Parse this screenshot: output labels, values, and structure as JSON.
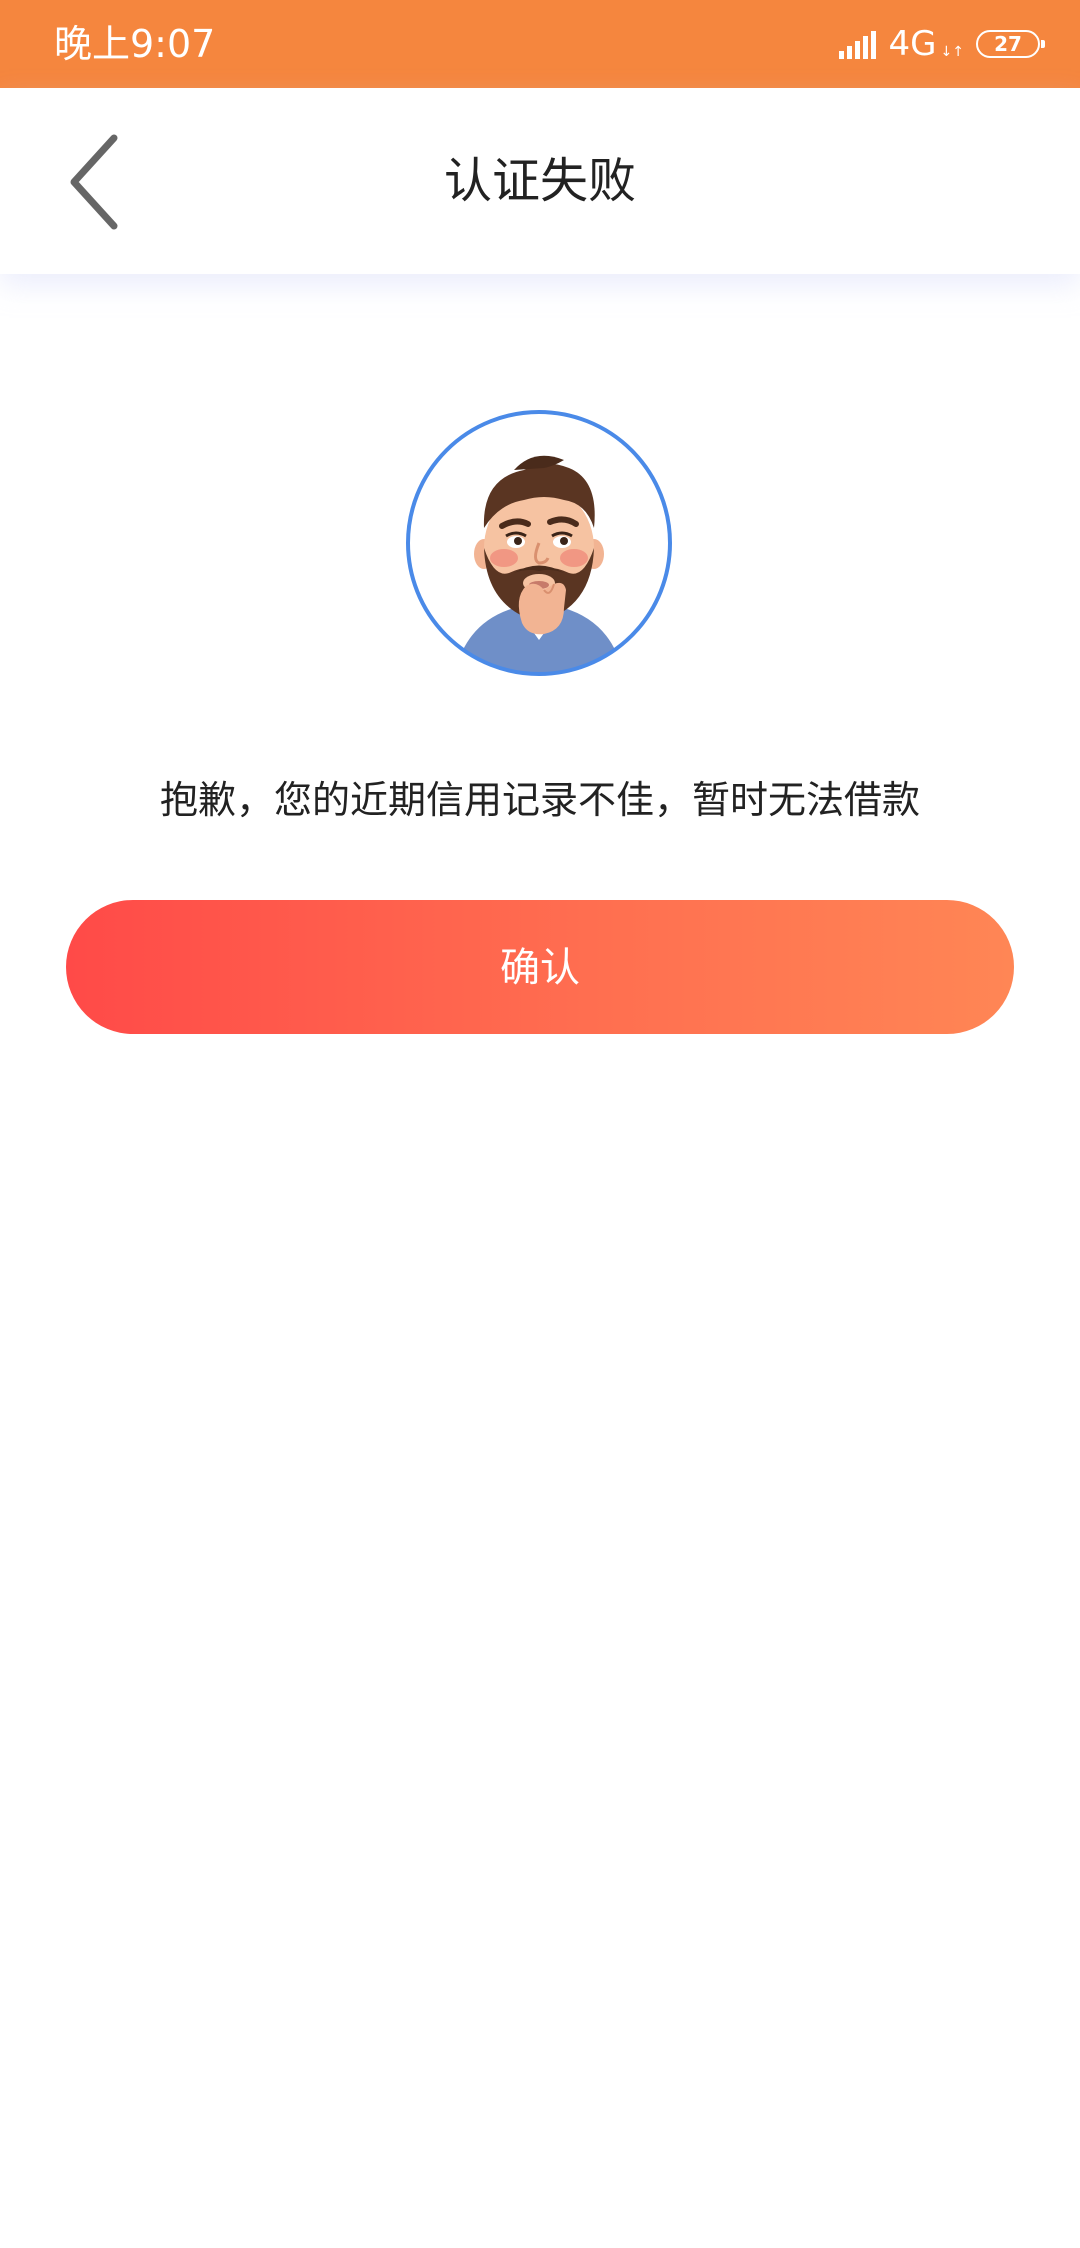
{
  "status_bar": {
    "time": "晚上9:07",
    "network": "4G",
    "battery": "27",
    "color": "#f5863e"
  },
  "header": {
    "title": "认证失败",
    "back_icon": "chevron-left-icon"
  },
  "illustration": {
    "icon": "thinking-man-avatar",
    "ring_color": "#4a8ae8"
  },
  "message": "抱歉，您的近期信用记录不佳，暂时无法借款",
  "confirm_button": {
    "label": "确认",
    "gradient_start": "#ff4a48",
    "gradient_end": "#ff8655"
  }
}
